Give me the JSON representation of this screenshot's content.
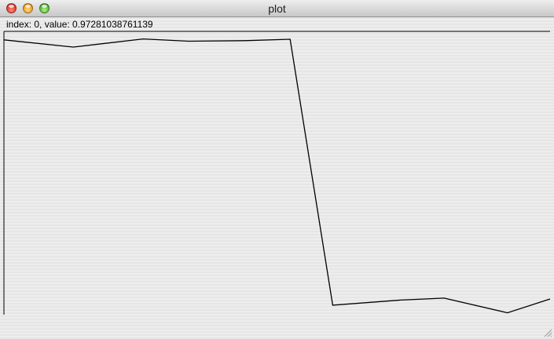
{
  "window": {
    "title": "plot",
    "status_text": "index: 0, value: 0.97281038761139"
  },
  "chart_data": {
    "type": "line",
    "title": "",
    "xlabel": "",
    "ylabel": "",
    "grid": false,
    "x": [
      0,
      1,
      2,
      3,
      4,
      5,
      6,
      7,
      8,
      9
    ],
    "series": [
      {
        "values": [
          0.9728,
          0.947,
          0.976,
          0.968,
          0.97,
          0.975,
          0.031,
          0.049,
          0.056,
          0.004,
          0.053
        ]
      }
    ],
    "line_color": "#000000"
  }
}
